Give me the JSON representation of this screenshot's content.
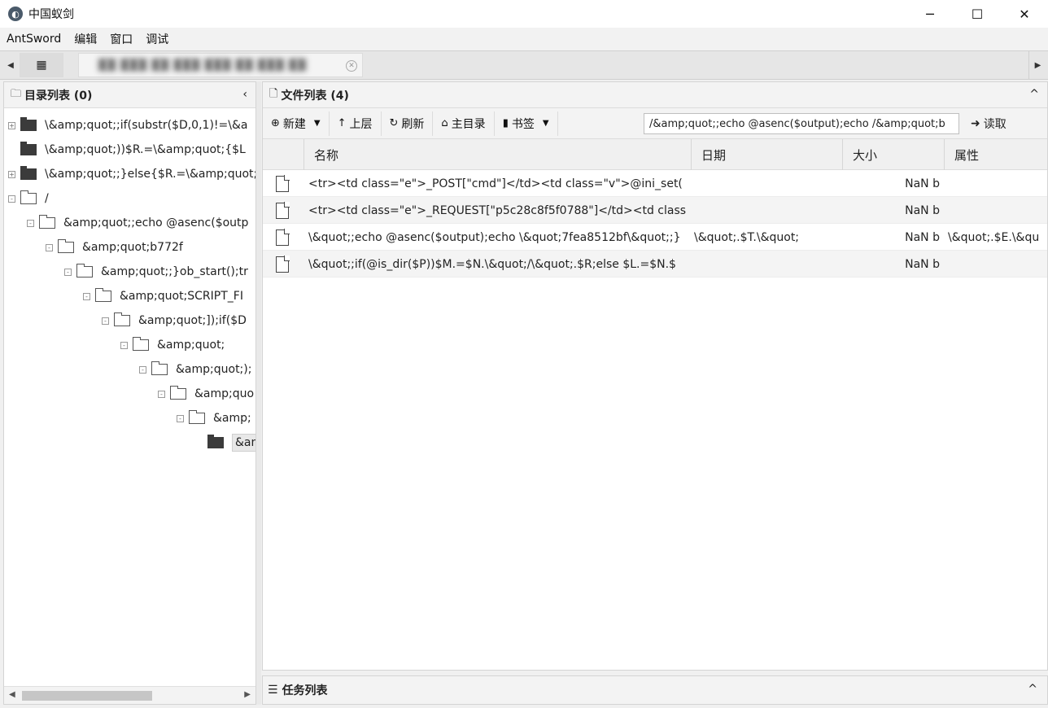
{
  "window": {
    "title": "中国蚁剑",
    "minimize": "─",
    "maximize": "☐",
    "close": "✕"
  },
  "menu": [
    "AntSword",
    "编辑",
    "窗口",
    "调试"
  ],
  "tabs": {
    "home_icon": "▦",
    "session_label": "██ ███ ██ ███ ███ ██ ███ ██",
    "close": "✕",
    "left_arrow": "◀",
    "right_arrow": "▶"
  },
  "left": {
    "title": "目录列表 (0)",
    "collapse": "‹",
    "tree": [
      {
        "label": "\\&amp;quot;;if(substr($D,0,1)!=\\&a",
        "expander": "+",
        "style": "filled",
        "depth": 0
      },
      {
        "label": "\\&amp;quot;))$R.=\\&amp;quot;{$L",
        "expander": "",
        "style": "filled",
        "depth": 0
      },
      {
        "label": "\\&amp;quot;;}else{$R.=\\&amp;quot;",
        "expander": "+",
        "style": "filled",
        "depth": 0
      },
      {
        "label": "/",
        "expander": "-",
        "style": "outline",
        "depth": 0
      },
      {
        "label": "&amp;quot;;echo @asenc($outp",
        "expander": "-",
        "style": "outline",
        "depth": 1
      },
      {
        "label": "&amp;quot;b772f",
        "expander": "-",
        "style": "outline",
        "depth": 2
      },
      {
        "label": "&amp;quot;;}ob_start();tr",
        "expander": "-",
        "style": "outline",
        "depth": 3
      },
      {
        "label": "&amp;quot;SCRIPT_FI",
        "expander": "-",
        "style": "outline",
        "depth": 4
      },
      {
        "label": "&amp;quot;]);if($D",
        "expander": "-",
        "style": "outline",
        "depth": 5
      },
      {
        "label": "&amp;quot;",
        "expander": "-",
        "style": "outline",
        "depth": 6
      },
      {
        "label": "&amp;quot;);",
        "expander": "-",
        "style": "outline",
        "depth": 7
      },
      {
        "label": "&amp;quo",
        "expander": "-",
        "style": "outline",
        "depth": 8
      },
      {
        "label": "&amp;",
        "expander": "-",
        "style": "outline",
        "depth": 9
      },
      {
        "label": "&am",
        "expander": "",
        "style": "filled",
        "depth": 10,
        "selected": true
      }
    ]
  },
  "right": {
    "title": "文件列表 (4)",
    "collapse": "^",
    "toolbar": {
      "new": "新建",
      "up": "上层",
      "refresh": "刷新",
      "home": "主目录",
      "bookmark": "书签",
      "path": "/&amp;quot;;echo @asenc($output);echo /&amp;quot;b",
      "read": "读取"
    },
    "columns": [
      "名称",
      "日期",
      "大小",
      "属性"
    ],
    "rows": [
      {
        "name": "<tr><td class=\"e\">_POST[\"cmd\"]</td><td class=\"v\">@ini_set(",
        "date": "",
        "size": "NaN b",
        "attr": ""
      },
      {
        "name": "<tr><td class=\"e\">_REQUEST[\"p5c28c8f5f0788\"]</td><td class",
        "date": "",
        "size": "NaN b",
        "attr": ""
      },
      {
        "name": "\\&quot;;echo @asenc($output);echo \\&quot;7fea8512bf\\&quot;;}",
        "date": "\\&quot;.$T.\\&quot;",
        "size": "NaN b",
        "attr": "\\&quot;.$E.\\&qu"
      },
      {
        "name": "\\&quot;;if(@is_dir($P))$M.=$N.\\&quot;/\\&quot;.$R;else $L.=$N.$",
        "date": "",
        "size": "NaN b",
        "attr": ""
      }
    ]
  },
  "tasks": {
    "title": "任务列表",
    "collapse": "^"
  }
}
